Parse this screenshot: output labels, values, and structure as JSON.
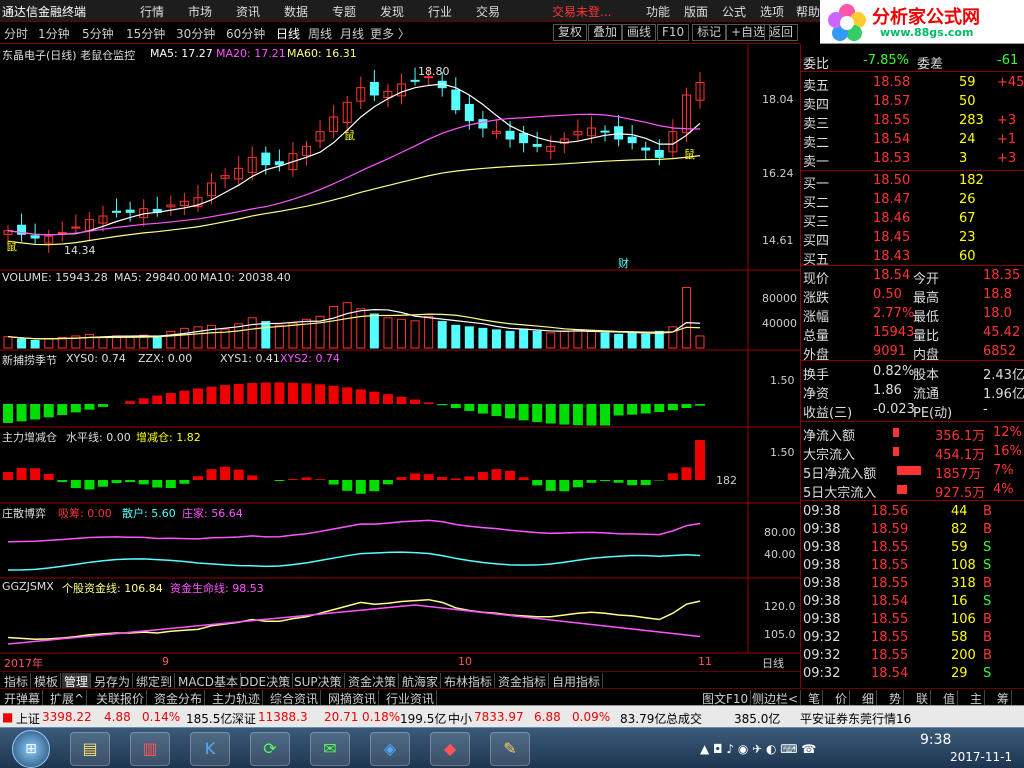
{
  "app": {
    "title": "通达信金融终端",
    "menu": [
      "行情",
      "市场",
      "资讯",
      "数据",
      "专题",
      "发现",
      "行业",
      "交易"
    ],
    "warning": "交易未登...",
    "menu_right": [
      "功能",
      "版面",
      "公式",
      "选项",
      "帮助"
    ],
    "logo_text": "分析家公式网",
    "logo_url": "www.88gs.com"
  },
  "period_tabs": [
    "分时",
    "1分钟",
    "5分钟",
    "15分钟",
    "30分钟",
    "60分钟",
    "日线",
    "周线",
    "月线",
    "更多 〉"
  ],
  "active_period": "日线",
  "toolbar_buttons": [
    "复权",
    "叠加",
    "画线",
    "F10",
    "标记",
    "+自选",
    "返回"
  ],
  "main_chart": {
    "header_name": "东晶电子(日线) 老鼠仓监控",
    "ma5": "MA5: 17.27",
    "ma20": "MA20: 17.21",
    "ma60": "MA60: 16.31",
    "high_label": "18.80",
    "low_label": "14.34",
    "mark_shu": "鼠",
    "mark_cai": "财",
    "y_labels": [
      "18.04",
      "16.24",
      "14.61"
    ]
  },
  "volume_panel": {
    "label": "VOLUME: 15943.28",
    "ma5": "MA5: 29840.00",
    "ma10": "MA10: 20038.40",
    "y_labels": [
      "80000",
      "40000"
    ]
  },
  "panel3": {
    "name": "新捕捞季节",
    "xys0": "XYS0: 0.74",
    "zzx": "ZZX: 0.00",
    "xys1": "XYS1: 0.41",
    "xys2": "XYS2: 0.74",
    "y_label": "1.50"
  },
  "panel4": {
    "name": "主力增减仓",
    "level": "水平线: 0.00",
    "chg": "增减仓: 1.82",
    "y_label": "1.50",
    "y_value": "182"
  },
  "panel5": {
    "name": "庄散博弈",
    "a": "吸筹: 0.00",
    "b": "散户: 5.60",
    "c": "庄家: 56.64",
    "y_labels": [
      "80.00",
      "40.00"
    ]
  },
  "panel6": {
    "name": "GGZJSMX",
    "a": "个股资金线: 106.84",
    "b": "资金生命线: 98.53",
    "y_labels": [
      "120.0",
      "105.0"
    ]
  },
  "x_axis": {
    "labels": [
      "2017年",
      "9",
      "10",
      "11"
    ],
    "mode": "日线"
  },
  "chart_data": {
    "type": "candlestick",
    "close_series_approx": [
      14.5,
      14.4,
      14.3,
      14.35,
      14.45,
      14.6,
      14.8,
      14.9,
      15.0,
      15.0,
      15.1,
      15.0,
      15.2,
      15.3,
      15.4,
      15.8,
      16.0,
      16.2,
      16.5,
      16.3,
      16.3,
      16.6,
      16.8,
      17.2,
      17.6,
      18.0,
      18.4,
      18.2,
      18.3,
      18.5,
      18.6,
      18.7,
      18.4,
      17.8,
      17.5,
      17.3,
      17.2,
      17.0,
      16.9,
      16.8,
      16.8,
      17.0,
      17.2,
      17.3,
      17.2,
      17.0,
      16.9,
      16.7,
      16.5,
      17.2,
      18.2,
      18.54
    ],
    "volume_series_approx": [
      15000,
      12000,
      10000,
      12000,
      14000,
      16000,
      18000,
      14000,
      16000,
      15000,
      17000,
      16000,
      22000,
      26000,
      28000,
      30000,
      25000,
      32000,
      40000,
      35000,
      30000,
      33000,
      38000,
      42000,
      55000,
      60000,
      52000,
      45000,
      40000,
      38000,
      36000,
      42000,
      35000,
      30000,
      28000,
      26000,
      24000,
      22000,
      25000,
      22000,
      20000,
      22000,
      24000,
      22000,
      20000,
      18000,
      20000,
      18000,
      22000,
      28000,
      80000,
      15943
    ]
  },
  "quote": {
    "weibi": {
      "label": "委比",
      "value": "-7.85%",
      "label2": "委差",
      "value2": "-61"
    },
    "asks": [
      {
        "label": "卖五",
        "price": "18.58",
        "vol": "59",
        "chg": "+45"
      },
      {
        "label": "卖四",
        "price": "18.57",
        "vol": "50",
        "chg": ""
      },
      {
        "label": "卖三",
        "price": "18.55",
        "vol": "283",
        "chg": "+3"
      },
      {
        "label": "卖二",
        "price": "18.54",
        "vol": "24",
        "chg": "+1"
      },
      {
        "label": "卖一",
        "price": "18.53",
        "vol": "3",
        "chg": "+3"
      }
    ],
    "bids": [
      {
        "label": "买一",
        "price": "18.50",
        "vol": "182"
      },
      {
        "label": "买二",
        "price": "18.47",
        "vol": "26"
      },
      {
        "label": "买三",
        "price": "18.46",
        "vol": "67"
      },
      {
        "label": "买四",
        "price": "18.45",
        "vol": "23"
      },
      {
        "label": "买五",
        "price": "18.43",
        "vol": "60"
      }
    ],
    "stats": [
      {
        "l1": "现价",
        "v1": "18.54",
        "l2": "今开",
        "v2": "18.35"
      },
      {
        "l1": "涨跌",
        "v1": "0.50",
        "l2": "最高",
        "v2": "18.8"
      },
      {
        "l1": "涨幅",
        "v1": "2.77%",
        "l2": "最低",
        "v2": "18.0"
      },
      {
        "l1": "总量",
        "v1": "15943",
        "l2": "量比",
        "v2": "45.42"
      },
      {
        "l1": "外盘",
        "v1": "9091",
        "l2": "内盘",
        "v2": "6852"
      }
    ],
    "stats2": [
      {
        "l1": "换手",
        "v1": "0.82%",
        "l2": "股本",
        "v2": "2.43亿"
      },
      {
        "l1": "净资",
        "v1": "1.86",
        "l2": "流通",
        "v2": "1.96亿"
      },
      {
        "l1": "收益(三)",
        "v1": "-0.023",
        "l2": "PE(动)",
        "v2": "-"
      }
    ],
    "flows": [
      {
        "label": "净流入额",
        "value": "356.1万",
        "pct": "12%"
      },
      {
        "label": "大宗流入",
        "value": "454.1万",
        "pct": "16%"
      },
      {
        "label": "5日净流入额",
        "value": "1857万",
        "pct": "7%"
      },
      {
        "label": "5日大宗流入",
        "value": "927.5万",
        "pct": "4%"
      }
    ],
    "ticks": [
      {
        "t": "09:38",
        "p": "18.56",
        "v": "44",
        "s": "B"
      },
      {
        "t": "09:38",
        "p": "18.59",
        "v": "82",
        "s": "B"
      },
      {
        "t": "09:38",
        "p": "18.55",
        "v": "59",
        "s": "S"
      },
      {
        "t": "09:38",
        "p": "18.55",
        "v": "108",
        "s": "S"
      },
      {
        "t": "09:38",
        "p": "18.55",
        "v": "318",
        "s": "B"
      },
      {
        "t": "09:38",
        "p": "18.54",
        "v": "16",
        "s": "S"
      },
      {
        "t": "09:38",
        "p": "18.55",
        "v": "106",
        "s": "B"
      },
      {
        "t": "09:32",
        "p": "18.55",
        "v": "58",
        "s": "B"
      },
      {
        "t": "09:32",
        "p": "18.55",
        "v": "200",
        "s": "B"
      },
      {
        "t": "09:32",
        "p": "18.54",
        "v": "29",
        "s": "S"
      }
    ],
    "side_tabs": [
      "笔",
      "价",
      "细",
      "势",
      "联",
      "值",
      "主",
      "筹"
    ]
  },
  "bottom_tabs1": [
    "指标",
    "模板",
    "管理",
    "另存为",
    "绑定到",
    "MACD基本",
    "DDE决策",
    "SUP决策",
    "资金决策",
    "航海家",
    "布林指标",
    "资金指标",
    "自用指标"
  ],
  "bottom_tabs1_active": "管理",
  "bottom_tabs2": [
    "开弹幕",
    "扩展^",
    "关联报价",
    "资金分布",
    "主力轨迹",
    "综合资讯",
    "网摘资讯",
    "行业资讯"
  ],
  "bottom_right": [
    "图文F10",
    "侧边栏<"
  ],
  "status_bar": {
    "sh_label": "上证",
    "sh_val": "3398.22",
    "sh_chg": "4.88",
    "sh_pct": "0.14%",
    "sh_amt": "185.5亿",
    "sz_label": "深证",
    "sz_val": "11388.3",
    "sz_chg": "20.71",
    "sz_pct": "0.18%",
    "sz_amt": "199.5亿",
    "zx_label": "中小",
    "zx_val": "7833.97",
    "zx_chg": "6.88",
    "zx_pct": "0.09%",
    "zx_amt": "83.79亿",
    "total_label": "总成交",
    "total_amt": "385.0亿",
    "broker": "平安证券东莞行情16"
  },
  "taskbar": {
    "time": "9:38",
    "date": "2017-11-1"
  }
}
